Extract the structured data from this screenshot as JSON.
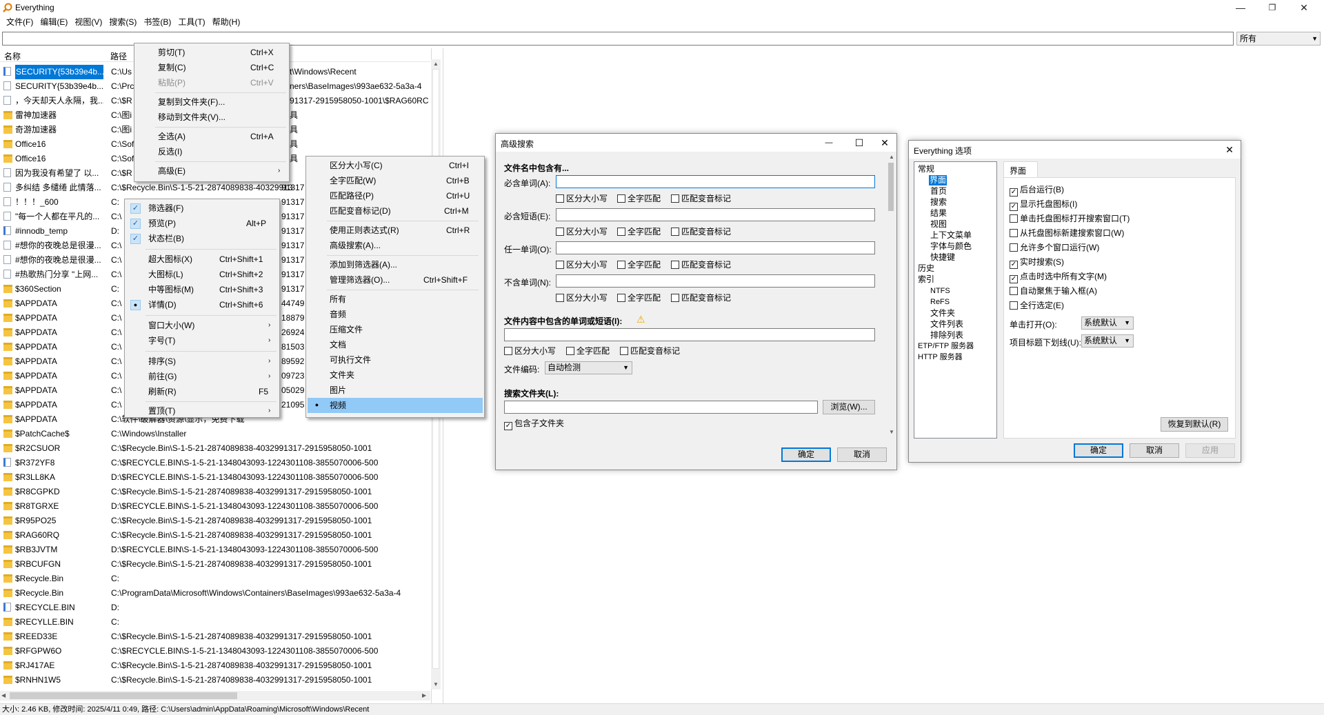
{
  "window": {
    "title": "Everything",
    "controls": {
      "minimize": "—",
      "maximize": "❐",
      "close": "✕"
    }
  },
  "menubar": [
    "文件(F)",
    "编辑(E)",
    "视图(V)",
    "搜索(S)",
    "书签(B)",
    "工具(T)",
    "帮助(H)"
  ],
  "search": {
    "value": "",
    "filter": "所有"
  },
  "list": {
    "col_name": "名称",
    "col_path": "路径",
    "rows": [
      {
        "icon": "fileshort",
        "name": "SECURITY{53b39e4b...",
        "path": "C:\\Us",
        "sel": true
      },
      {
        "icon": "file",
        "name": "SECURITY{53b39e4b...",
        "path": "C:\\Prc"
      },
      {
        "icon": "file",
        "name": "，今天却天人永隔，我...",
        "path": "C:\\$R"
      },
      {
        "icon": "folder",
        "name": "雷神加速器",
        "path": "C:\\图i"
      },
      {
        "icon": "folder",
        "name": "奇游加速器",
        "path": "C:\\图i"
      },
      {
        "icon": "folder",
        "name": "Office16",
        "path": "C:\\Sof"
      },
      {
        "icon": "folder",
        "name": "Office16",
        "path": "C:\\Sof"
      },
      {
        "icon": "file",
        "name": "因为我没有希望了 以...",
        "path": "C:\\$R"
      },
      {
        "icon": "file",
        "name": "多纠结 多缱绻 此情落...",
        "path": "C:\\$Recycle.Bin\\S-1-5-21-2874089838-40329913"
      },
      {
        "icon": "file",
        "name": "！！！_600",
        "path": "C:"
      },
      {
        "icon": "file",
        "name": "\"每一个人都在平凡的...",
        "path": "C:\\"
      },
      {
        "icon": "fileshort",
        "name": "#innodb_temp",
        "path": "D:"
      },
      {
        "icon": "file",
        "name": "#想你的夜晚总是很漫...",
        "path": "C:\\"
      },
      {
        "icon": "file",
        "name": "#想你的夜晚总是很漫...",
        "path": "C:\\"
      },
      {
        "icon": "file",
        "name": "#热歌热门分享 \"上网...",
        "path": "C:\\"
      },
      {
        "icon": "folder",
        "name": "$360Section",
        "path": "C:"
      },
      {
        "icon": "folder",
        "name": "$APPDATA",
        "path": "C:\\"
      },
      {
        "icon": "folder",
        "name": "$APPDATA",
        "path": "C:\\"
      },
      {
        "icon": "folder",
        "name": "$APPDATA",
        "path": "C:\\"
      },
      {
        "icon": "folder",
        "name": "$APPDATA",
        "path": "C:\\"
      },
      {
        "icon": "folder",
        "name": "$APPDATA",
        "path": "C:\\"
      },
      {
        "icon": "folder",
        "name": "$APPDATA",
        "path": "C:\\"
      },
      {
        "icon": "folder",
        "name": "$APPDATA",
        "path": "C:\\"
      },
      {
        "icon": "folder",
        "name": "$APPDATA",
        "path": "C:\\"
      },
      {
        "icon": "folder",
        "name": "$APPDATA",
        "path": "C:\\软件\\破解器\\资源\\显示，免费下载"
      },
      {
        "icon": "folder",
        "name": "$PatchCache$",
        "path": "C:\\Windows\\Installer"
      },
      {
        "icon": "folder",
        "name": "$R2CSUOR",
        "path": "C:\\$Recycle.Bin\\S-1-5-21-2874089838-4032991317-2915958050-1001"
      },
      {
        "icon": "fileshort",
        "name": "$R372YF8",
        "path": "C:\\$RECYCLE.BIN\\S-1-5-21-1348043093-1224301108-3855070006-500"
      },
      {
        "icon": "folder",
        "name": "$R3LL8KA",
        "path": "D:\\$RECYCLE.BIN\\S-1-5-21-1348043093-1224301108-3855070006-500"
      },
      {
        "icon": "folder",
        "name": "$R8CGPKD",
        "path": "C:\\$Recycle.Bin\\S-1-5-21-2874089838-4032991317-2915958050-1001"
      },
      {
        "icon": "folder",
        "name": "$R8TGRXE",
        "path": "D:\\$RECYCLE.BIN\\S-1-5-21-1348043093-1224301108-3855070006-500"
      },
      {
        "icon": "folder",
        "name": "$R95PO25",
        "path": "C:\\$Recycle.Bin\\S-1-5-21-2874089838-4032991317-2915958050-1001"
      },
      {
        "icon": "folder",
        "name": "$RAG60RQ",
        "path": "C:\\$Recycle.Bin\\S-1-5-21-2874089838-4032991317-2915958050-1001"
      },
      {
        "icon": "folder",
        "name": "$RB3JVTM",
        "path": "D:\\$RECYCLE.BIN\\S-1-5-21-1348043093-1224301108-3855070006-500"
      },
      {
        "icon": "folder",
        "name": "$RBCUFGN",
        "path": "C:\\$Recycle.Bin\\S-1-5-21-2874089838-4032991317-2915958050-1001"
      },
      {
        "icon": "folder",
        "name": "$Recycle.Bin",
        "path": "C:"
      },
      {
        "icon": "folder",
        "name": "$Recycle.Bin",
        "path": "C:\\ProgramData\\Microsoft\\Windows\\Containers\\BaseImages\\993ae632-5a3a-4"
      },
      {
        "icon": "fileshort",
        "name": "$RECYCLE.BIN",
        "path": "D:"
      },
      {
        "icon": "folder",
        "name": "$RECYLLE.BIN",
        "path": "C:"
      },
      {
        "icon": "folder",
        "name": "$REED33E",
        "path": "C:\\$Recycle.Bin\\S-1-5-21-2874089838-4032991317-2915958050-1001"
      },
      {
        "icon": "folder",
        "name": "$RFGPW6O",
        "path": "C:\\$RECYCLE.BIN\\S-1-5-21-1348043093-1224301108-3855070006-500"
      },
      {
        "icon": "folder",
        "name": "$RJ417AE",
        "path": "C:\\$Recycle.Bin\\S-1-5-21-2874089838-4032991317-2915958050-1001"
      },
      {
        "icon": "folder",
        "name": "$RNHN1W5",
        "path": "C:\\$Recycle.Bin\\S-1-5-21-2874089838-4032991317-2915958050-1001"
      }
    ],
    "path_overflow": [
      "t\\Windows\\Recent",
      "ners\\BaseImages\\993ae632-5a3a-4",
      "91317-2915958050-1001\\$RAG60RC",
      "具",
      "具",
      "具",
      "具"
    ],
    "path_tails": [
      "91317",
      "91317",
      "91317",
      "91317",
      "91317",
      "91317",
      "91317",
      "91317",
      "44749",
      "18879",
      "26924",
      "81503",
      "89592",
      "09723",
      "05029",
      "21095"
    ]
  },
  "status": "大小: 2.46 KB, 修改时间: 2025/4/11 0:49, 路径: C:\\Users\\admin\\AppData\\Roaming\\Microsoft\\Windows\\Recent",
  "edit_menu": {
    "items": [
      {
        "label": "剪切(T)",
        "shortcut": "Ctrl+X"
      },
      {
        "label": "复制(C)",
        "shortcut": "Ctrl+C"
      },
      {
        "label": "粘贴(P)",
        "shortcut": "Ctrl+V",
        "disabled": true
      },
      {
        "label": "复制到文件夹(F)...",
        "shortcut": ""
      },
      {
        "label": "移动到文件夹(V)...",
        "shortcut": ""
      },
      {
        "label": "全选(A)",
        "shortcut": "Ctrl+A"
      },
      {
        "label": "反选(I)",
        "shortcut": ""
      },
      {
        "label": "高级(E)",
        "shortcut": "",
        "submenu": "›"
      }
    ]
  },
  "view_menu": {
    "items": [
      {
        "label": "筛选器(F)",
        "shortcut": "",
        "check": "✓"
      },
      {
        "label": "预览(P)",
        "shortcut": "Alt+P",
        "check": "✓"
      },
      {
        "label": "状态栏(B)",
        "shortcut": "",
        "check": "✓"
      },
      {
        "label": "超大图标(X)",
        "shortcut": "Ctrl+Shift+1"
      },
      {
        "label": "大图标(L)",
        "shortcut": "Ctrl+Shift+2"
      },
      {
        "label": "中等图标(M)",
        "shortcut": "Ctrl+Shift+3"
      },
      {
        "label": "详情(D)",
        "shortcut": "Ctrl+Shift+6",
        "dot": "●"
      },
      {
        "label": "窗口大小(W)",
        "shortcut": "",
        "submenu": "›"
      },
      {
        "label": "字号(T)",
        "shortcut": "",
        "submenu": "›"
      },
      {
        "label": "排序(S)",
        "shortcut": "",
        "submenu": "›"
      },
      {
        "label": "前往(G)",
        "shortcut": "",
        "submenu": "›"
      },
      {
        "label": "刷新(R)",
        "shortcut": "F5"
      },
      {
        "label": "置顶(T)",
        "shortcut": "",
        "submenu": "›"
      }
    ]
  },
  "search_menu": {
    "items": [
      {
        "label": "区分大小写(C)",
        "shortcut": "Ctrl+I"
      },
      {
        "label": "全字匹配(W)",
        "shortcut": "Ctrl+B"
      },
      {
        "label": "匹配路径(P)",
        "shortcut": "Ctrl+U"
      },
      {
        "label": "匹配变音标记(D)",
        "shortcut": "Ctrl+M"
      },
      {
        "label": "使用正则表达式(R)",
        "shortcut": "Ctrl+R"
      },
      {
        "label": "高级搜索(A)...",
        "shortcut": ""
      },
      {
        "label": "添加到筛选器(A)...",
        "shortcut": ""
      },
      {
        "label": "管理筛选器(O)...",
        "shortcut": "Ctrl+Shift+F"
      },
      {
        "label": "所有",
        "shortcut": ""
      },
      {
        "label": "音频",
        "shortcut": ""
      },
      {
        "label": "压缩文件",
        "shortcut": ""
      },
      {
        "label": "文档",
        "shortcut": ""
      },
      {
        "label": "可执行文件",
        "shortcut": ""
      },
      {
        "label": "文件夹",
        "shortcut": ""
      },
      {
        "label": "图片",
        "shortcut": ""
      },
      {
        "label": "视频",
        "shortcut": "",
        "dot": "●"
      }
    ]
  },
  "advanced": {
    "title": "高级搜索",
    "controls": {
      "minimize": "—",
      "maximize": "☐",
      "close": "✕"
    },
    "section_name": "文件名中包含有...",
    "must_word": "必含单词(A):",
    "must_phrase": "必含短语(E):",
    "any_word": "任一单词(O):",
    "none_word": "不含单词(N):",
    "opt_case": "区分大小写",
    "opt_whole": "全字匹配",
    "opt_diacritic": "匹配变音标记",
    "section_content": "文件内容中包含的单词或短语(I):",
    "warn_icon": "⚠",
    "encoding_label": "文件编码:",
    "encoding_value": "自动检测",
    "section_folder": "搜索文件夹(L):",
    "browse": "浏览(W)...",
    "include_sub": "包含子文件夹",
    "ok": "确定",
    "cancel": "取消",
    "check": "✓"
  },
  "options": {
    "title": "Everything 选项",
    "close": "✕",
    "tree": [
      "常规",
      "界面",
      "首页",
      "搜索",
      "结果",
      "视图",
      "上下文菜单",
      "字体与颜色",
      "快捷键",
      "历史",
      "索引",
      "NTFS",
      "ReFS",
      "文件夹",
      "文件列表",
      "排除列表",
      "ETP/FTP 服务器",
      "HTTP 服务器"
    ],
    "tab": "界面",
    "checks": [
      {
        "label": "后台运行(B)",
        "checked": true
      },
      {
        "label": "显示托盘图标(I)",
        "checked": true
      },
      {
        "label": "单击托盘图标打开搜索窗口(T)",
        "checked": false
      },
      {
        "label": "从托盘图标新建搜索窗口(W)",
        "checked": false
      },
      {
        "label": "允许多个窗口运行(W)",
        "checked": false
      },
      {
        "label": "实时搜索(S)",
        "checked": true
      },
      {
        "label": "点击时选中所有文字(M)",
        "checked": true
      },
      {
        "label": "自动聚焦于输入框(A)",
        "checked": false
      },
      {
        "label": "全行选定(E)",
        "checked": false
      }
    ],
    "check_mark": "✓",
    "single_click_label": "单击打开(O):",
    "single_click_value": "系统默认",
    "underline_label": "项目标题下划线(U):",
    "underline_value": "系统默认",
    "restore": "恢复到默认(R)",
    "ok": "确定",
    "cancel": "取消",
    "apply": "应用"
  }
}
